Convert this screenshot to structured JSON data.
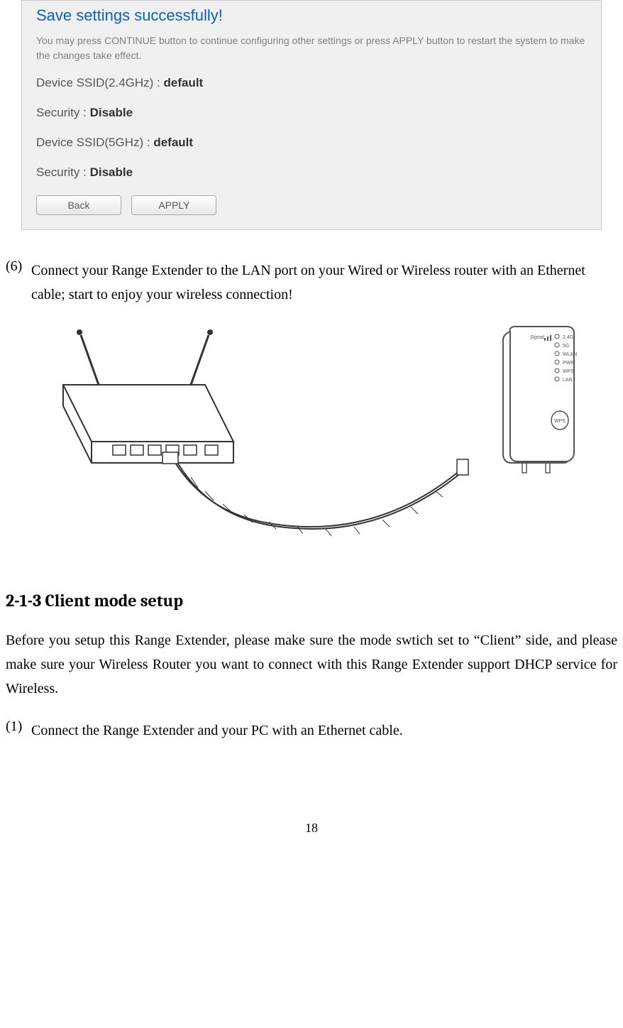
{
  "panel": {
    "title": "Save settings successfully!",
    "subtitle": "You may press CONTINUE button to continue configuring other settings or press APPLY button to restart the system to make the changes take effect.",
    "rows": [
      {
        "label": "Device SSID(2.4GHz) : ",
        "value": "default"
      },
      {
        "label": "Security : ",
        "value": "Disable"
      },
      {
        "label": "Device SSID(5GHz) : ",
        "value": "default"
      },
      {
        "label": "Security : ",
        "value": "Disable"
      }
    ],
    "buttons": {
      "back": "Back",
      "apply": "APPLY"
    }
  },
  "step6": {
    "marker": "(6)",
    "text": "Connect your Range Extender to the LAN port on your Wired or Wireless router with an Ethernet cable; start to enjoy your wireless connection!"
  },
  "diagram": {
    "leds": [
      "2.4G",
      "5G",
      "WLAN",
      "PWR",
      "WPS",
      "LAN"
    ],
    "signal_label": "Signal",
    "wps_label": "WPS"
  },
  "heading": "2-1-3 Client mode setup",
  "intro": "Before you setup this Range Extender, please make sure the mode swtich set to “Client” side, and please make sure your Wireless Router you want to connect with this Range Extender support DHCP service for Wireless.",
  "step1": {
    "marker": "(1)",
    "text": "Connect the Range Extender and your PC with an Ethernet cable."
  },
  "page_number": "18"
}
